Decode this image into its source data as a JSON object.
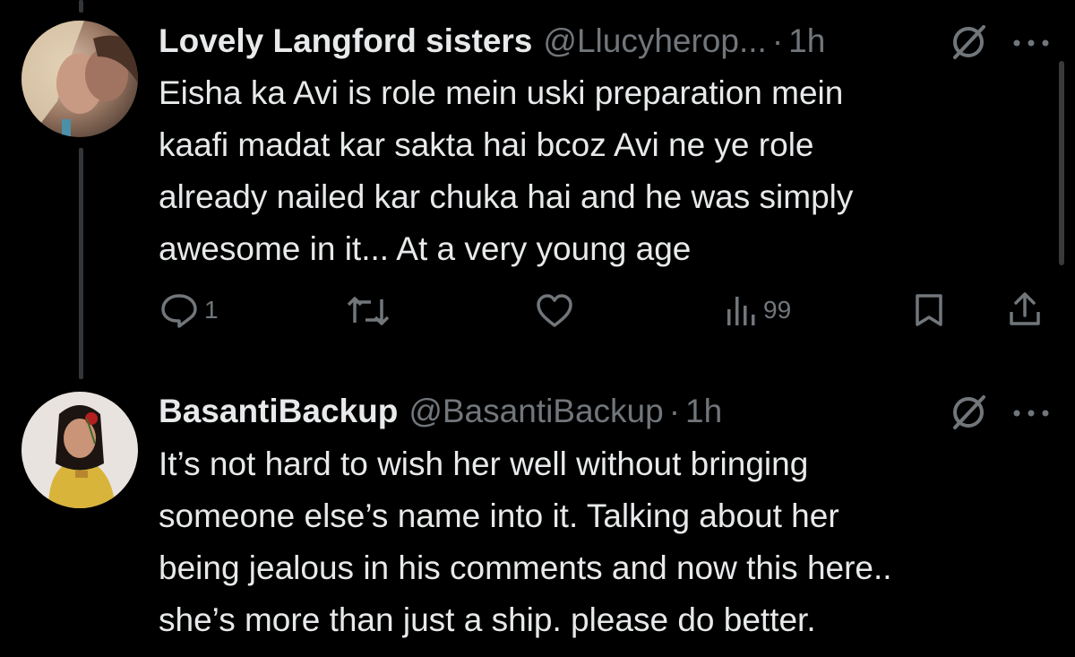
{
  "tweets": [
    {
      "name": "Lovely Langford sisters",
      "handle": "@Llucyherop...",
      "separator": "·",
      "time": "1h",
      "lines": [
        "Eisha ka Avi is role mein uski preparation mein",
        "kaafi madat kar sakta hai bcoz Avi ne ye role",
        "already  nailed kar chuka hai and he was simply",
        "awesome in it... At a very young age"
      ],
      "actions": {
        "reply": {
          "icon": "reply-icon",
          "count": "1"
        },
        "retweet": {
          "icon": "retweet-icon",
          "count": ""
        },
        "like": {
          "icon": "heart-icon",
          "count": ""
        },
        "views": {
          "icon": "views-icon",
          "count": "99"
        },
        "bookmark": {
          "icon": "bookmark-icon"
        },
        "share": {
          "icon": "share-icon"
        }
      }
    },
    {
      "name": "BasantiBackup",
      "handle": "@BasantiBackup",
      "separator": "·",
      "time": "1h",
      "lines": [
        "It’s not hard to wish her well without bringing",
        "someone else’s name into it. Talking about her",
        "being jealous in his comments and now this here..",
        "she’s more than just a ship. please do better."
      ]
    }
  ],
  "colors": {
    "background": "#000000",
    "text": "#e7e9ea",
    "secondary": "#71767b",
    "thread_line": "#333639"
  }
}
